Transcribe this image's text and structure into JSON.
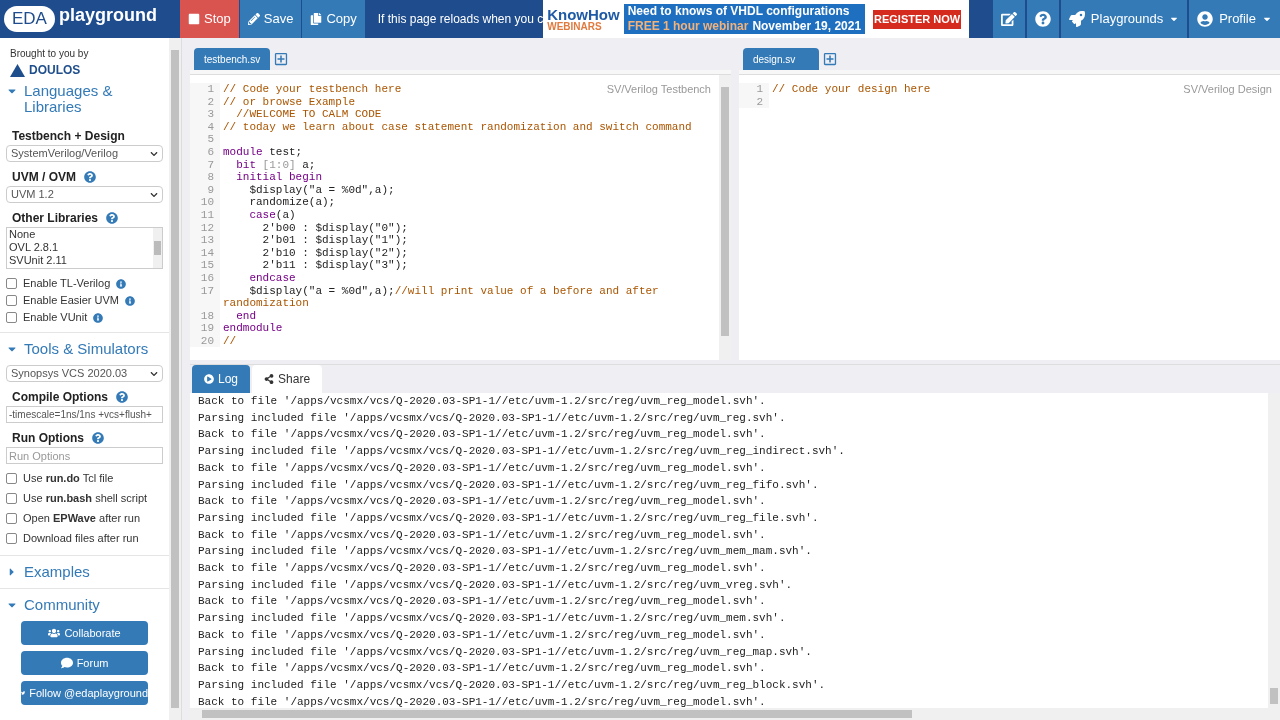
{
  "topbar": {
    "logo_mark": "EDA",
    "logo_text": "playground",
    "actions": [
      {
        "kind": "stop",
        "label": "Stop"
      },
      {
        "kind": "save",
        "label": "Save"
      },
      {
        "kind": "copy",
        "label": "Copy"
      }
    ],
    "notice": "If this page reloads when you c",
    "ad": {
      "brand_top": "KnowHow",
      "brand_bottom": "WEBINARS",
      "headline": "Need to knows of VHDL configurations",
      "offer": "FREE 1 hour webinar",
      "date": "November 19, 2021",
      "cta": "REGISTER NOW"
    },
    "menus": [
      {
        "kind": "edit"
      },
      {
        "kind": "help"
      },
      {
        "kind": "rocket",
        "label": "Playgrounds"
      },
      {
        "kind": "user",
        "label": "Profile"
      }
    ]
  },
  "sidebar": {
    "credit": "Brought to you by",
    "brand": "DOULOS",
    "languages": {
      "title": "Languages & Libraries",
      "expanded": true,
      "testbench_label": "Testbench + Design",
      "testbench_value": "SystemVerilog/Verilog",
      "uvm_label": "UVM / OVM",
      "uvm_value": "UVM 1.2",
      "libraries_label": "Other Libraries",
      "libraries": [
        "None",
        "OVL 2.8.1",
        "SVUnit 2.11"
      ],
      "options": [
        {
          "label": "Enable TL-Verilog",
          "checked": false,
          "info": true
        },
        {
          "label": "Enable Easier UVM",
          "checked": false,
          "info": true
        },
        {
          "label": "Enable VUnit",
          "checked": false,
          "info": true
        }
      ]
    },
    "tools": {
      "title": "Tools & Simulators",
      "expanded": true,
      "simulator": "Synopsys VCS 2020.03",
      "compile_label": "Compile Options",
      "compile_value": "-timescale=1ns/1ns +vcs+flush+",
      "run_label": "Run Options",
      "run_placeholder": "Run Options",
      "options": [
        {
          "label": "Use **run.do** Tcl file",
          "checked": false,
          "info": false
        },
        {
          "label": "Use **run.bash** shell script",
          "checked": false,
          "info": false
        },
        {
          "label": "Open **EPWave** after run",
          "checked": false,
          "info": false
        },
        {
          "label": "Download files after run",
          "checked": false,
          "info": false
        }
      ]
    },
    "examples": {
      "title": "Examples",
      "expanded": false
    },
    "community": {
      "title": "Community",
      "expanded": true,
      "buttons": [
        {
          "kind": "users",
          "label": "Collaborate"
        },
        {
          "kind": "chat",
          "label": "Forum"
        },
        {
          "kind": "twitter",
          "label": "Follow @edaplayground"
        }
      ]
    }
  },
  "editors": [
    {
      "tabs": [
        {
          "label": "testbench.sv",
          "selected": true
        }
      ],
      "mode": "SV/Verilog Testbench",
      "lines": [
        {
          "number": "1",
          "tokens": [
            {
              "kind": "comment",
              "text": "// Code your testbench here"
            }
          ]
        },
        {
          "number": "2",
          "tokens": [
            {
              "kind": "comment",
              "text": "// or browse Example"
            }
          ]
        },
        {
          "number": "3",
          "tokens": [
            {
              "kind": "comment",
              "text": "  //WELCOME TO CALM CODE"
            }
          ]
        },
        {
          "number": "4",
          "tokens": [
            {
              "kind": "comment",
              "text": "// today we learn about case statement randomization and switch command"
            }
          ]
        },
        {
          "number": "5"
        },
        {
          "number": "6",
          "tokens": [
            {
              "kind": "keyword",
              "text": "module"
            },
            {
              "kind": "plain",
              "text": " test;"
            }
          ]
        },
        {
          "number": "7",
          "tokens": [
            {
              "kind": "keyword",
              "text": "  bit"
            },
            {
              "kind": "dim",
              "text": " [1:0]"
            },
            {
              "kind": "plain",
              "text": " a;"
            }
          ]
        },
        {
          "number": "8",
          "tokens": [
            {
              "kind": "keyword",
              "text": "  initial begin"
            }
          ]
        },
        {
          "number": "9",
          "tokens": [
            {
              "kind": "plain",
              "text": "    $display(\"a = %0d\",a);"
            }
          ]
        },
        {
          "number": "10",
          "tokens": [
            {
              "kind": "plain",
              "text": "    randomize(a);"
            }
          ]
        },
        {
          "number": "11",
          "tokens": [
            {
              "kind": "keyword",
              "text": "    case"
            },
            {
              "kind": "plain",
              "text": "(a)"
            }
          ]
        },
        {
          "number": "12",
          "tokens": [
            {
              "kind": "plain",
              "text": "      2'b00 : $display(\"0\");"
            }
          ]
        },
        {
          "number": "13",
          "tokens": [
            {
              "kind": "plain",
              "text": "      2'b01 : $display(\"1\");"
            }
          ]
        },
        {
          "number": "14",
          "tokens": [
            {
              "kind": "plain",
              "text": "      2'b10 : $display(\"2\");"
            }
          ]
        },
        {
          "number": "15",
          "tokens": [
            {
              "kind": "plain",
              "text": "      2'b11 : $display(\"3\");"
            }
          ]
        },
        {
          "number": "16",
          "tokens": [
            {
              "kind": "keyword",
              "text": "    endcase"
            }
          ]
        },
        {
          "number": "17",
          "tokens": [
            {
              "kind": "plain",
              "text": "    $display(\"a = %0d\",a);"
            },
            {
              "kind": "comment",
              "text": "//will print value of a before and after randomization"
            }
          ]
        },
        {
          "number": "18",
          "tokens": [
            {
              "kind": "keyword",
              "text": "  end"
            }
          ]
        },
        {
          "number": "19",
          "tokens": [
            {
              "kind": "keyword",
              "text": "endmodule"
            }
          ]
        },
        {
          "number": "20",
          "tokens": [
            {
              "kind": "comment",
              "text": "//"
            }
          ]
        }
      ]
    },
    {
      "tabs": [
        {
          "label": "design.sv",
          "selected": true
        }
      ],
      "mode": "SV/Verilog Design",
      "lines": [
        {
          "number": "1",
          "tokens": [
            {
              "kind": "comment",
              "text": "// Code your design here"
            }
          ]
        },
        {
          "number": "2"
        }
      ]
    }
  ],
  "output": {
    "tabs": [
      {
        "kind": "log",
        "label": "Log",
        "selected": true
      },
      {
        "kind": "share",
        "label": "Share",
        "selected": false
      }
    ],
    "lines": [
      "Back to file '/apps/vcsmx/vcs/Q-2020.03-SP1-1//etc/uvm-1.2/src/reg/uvm_reg_model.svh'.",
      "Parsing included file '/apps/vcsmx/vcs/Q-2020.03-SP1-1//etc/uvm-1.2/src/reg/uvm_reg.svh'.",
      "Back to file '/apps/vcsmx/vcs/Q-2020.03-SP1-1//etc/uvm-1.2/src/reg/uvm_reg_model.svh'.",
      "Parsing included file '/apps/vcsmx/vcs/Q-2020.03-SP1-1//etc/uvm-1.2/src/reg/uvm_reg_indirect.svh'.",
      "Back to file '/apps/vcsmx/vcs/Q-2020.03-SP1-1//etc/uvm-1.2/src/reg/uvm_reg_model.svh'.",
      "Parsing included file '/apps/vcsmx/vcs/Q-2020.03-SP1-1//etc/uvm-1.2/src/reg/uvm_reg_fifo.svh'.",
      "Back to file '/apps/vcsmx/vcs/Q-2020.03-SP1-1//etc/uvm-1.2/src/reg/uvm_reg_model.svh'.",
      "Parsing included file '/apps/vcsmx/vcs/Q-2020.03-SP1-1//etc/uvm-1.2/src/reg/uvm_reg_file.svh'.",
      "Back to file '/apps/vcsmx/vcs/Q-2020.03-SP1-1//etc/uvm-1.2/src/reg/uvm_reg_model.svh'.",
      "Parsing included file '/apps/vcsmx/vcs/Q-2020.03-SP1-1//etc/uvm-1.2/src/reg/uvm_mem_mam.svh'.",
      "Back to file '/apps/vcsmx/vcs/Q-2020.03-SP1-1//etc/uvm-1.2/src/reg/uvm_reg_model.svh'.",
      "Parsing included file '/apps/vcsmx/vcs/Q-2020.03-SP1-1//etc/uvm-1.2/src/reg/uvm_vreg.svh'.",
      "Back to file '/apps/vcsmx/vcs/Q-2020.03-SP1-1//etc/uvm-1.2/src/reg/uvm_reg_model.svh'.",
      "Parsing included file '/apps/vcsmx/vcs/Q-2020.03-SP1-1//etc/uvm-1.2/src/reg/uvm_mem.svh'.",
      "Back to file '/apps/vcsmx/vcs/Q-2020.03-SP1-1//etc/uvm-1.2/src/reg/uvm_reg_model.svh'.",
      "Parsing included file '/apps/vcsmx/vcs/Q-2020.03-SP1-1//etc/uvm-1.2/src/reg/uvm_reg_map.svh'.",
      "Back to file '/apps/vcsmx/vcs/Q-2020.03-SP1-1//etc/uvm-1.2/src/reg/uvm_reg_model.svh'.",
      "Parsing included file '/apps/vcsmx/vcs/Q-2020.03-SP1-1//etc/uvm-1.2/src/reg/uvm_reg_block.svh'.",
      "Back to file '/apps/vcsmx/vcs/Q-2020.03-SP1-1//etc/uvm-1.2/src/reg/uvm_reg_model.svh'."
    ]
  }
}
